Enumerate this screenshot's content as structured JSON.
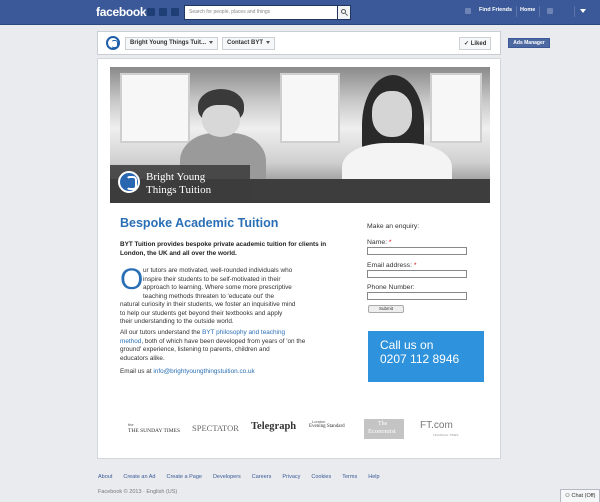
{
  "topbar": {
    "logo": "facebook",
    "search_placeholder": "Search for people, places and things",
    "find_friends": "Find Friends",
    "home": "Home"
  },
  "page_header": {
    "page_name": "Bright Young Things Tuit...",
    "contact_button": "Contact BYT",
    "liked_button": "✓ Liked",
    "ads_manager": "Ads Manager"
  },
  "hero": {
    "brand_line1": "Bright Young",
    "brand_line2": "Things Tuition"
  },
  "content": {
    "title": "Bespoke Academic Tuition",
    "intro": "BYT Tuition provides bespoke private academic tuition for clients in London, the UK and all over the world.",
    "dropcap": "O",
    "para1_lines": [
      "ur tutors are motivated, well-rounded individuals who",
      "inspire their students to be self-motivated in their",
      "approach to learning. Where some more prescriptive",
      "teaching methods threaten to 'educate out' the"
    ],
    "para1_rest": [
      "natural curiosity in their students, we foster an inquisitive mind",
      "to help our students get beyond their textbooks and apply",
      "their understanding to the outside world."
    ],
    "para2_before": "All our tutors understand the ",
    "para2_link1": "BYT philosophy and teaching",
    "para2_link2": "method",
    "para2_line2_after": ", both of which have been developed from years of 'on the",
    "para2_line3": "ground' experience, listening to parents, children and",
    "para2_line4": "educators alike.",
    "email_prefix": "Email us at ",
    "email": "info@brightyoungthingstuition.co.uk"
  },
  "form": {
    "title": "Make an enquiry:",
    "name_label": "Name: ",
    "email_label": "Email address: ",
    "phone_label": "Phone Number:",
    "required_mark": "*",
    "submit": "Submit"
  },
  "call_box": {
    "line1": "Call us on",
    "line2": "0207 112 8946"
  },
  "press": {
    "sunday_times_top": "the",
    "sunday_times": "THE SUNDAY TIMES",
    "spectator": "SPECTATOR",
    "telegraph": "Telegraph",
    "evening_top": "London",
    "evening_standard": "Evening Standard",
    "economist_line1": "The",
    "economist_line2": "Economist",
    "ft": "FT.com",
    "ft_sub": "FINANCIAL TIMES"
  },
  "footer": {
    "links": [
      "About",
      "Create an Ad",
      "Create a Page",
      "Developers",
      "Careers",
      "Privacy",
      "Cookies",
      "Terms",
      "Help"
    ],
    "copyright": "Facebook © 2013 · English (US)",
    "chat": "Chat (Off)"
  },
  "colors": {
    "facebook_blue": "#3b5998",
    "accent_blue": "#2a6fb5",
    "call_box": "#2e92dc"
  },
  "icons": [
    "friend-requests-icon",
    "messages-icon",
    "notifications-icon",
    "search-icon",
    "privacy-shortcuts-icon",
    "account-settings-icon",
    "chat-icon"
  ]
}
